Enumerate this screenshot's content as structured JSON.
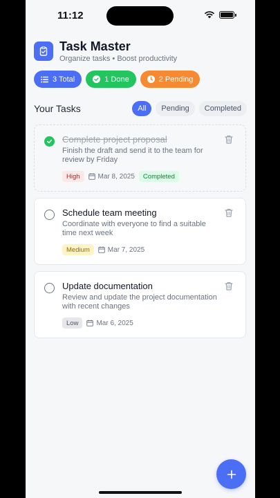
{
  "status_bar": {
    "time": "11:12"
  },
  "app": {
    "title": "Task Master",
    "subtitle": "Organize tasks • Boost productivity",
    "accent_color": "#4c6ef5"
  },
  "stats": {
    "total": "3 Total",
    "done": "1 Done",
    "pending": "2 Pending"
  },
  "section": {
    "title": "Your Tasks"
  },
  "filters": [
    {
      "label": "All",
      "active": true
    },
    {
      "label": "Pending",
      "active": false
    },
    {
      "label": "Completed",
      "active": false
    }
  ],
  "tasks": [
    {
      "title": "Complete project proposal",
      "description": "Finish the draft and send it to the team for review by Friday",
      "priority": "High",
      "date": "Mar 8, 2025",
      "status": "Completed",
      "done": true
    },
    {
      "title": "Schedule team meeting",
      "description": "Coordinate with everyone to find a suitable time next week",
      "priority": "Medium",
      "date": "Mar 7, 2025",
      "done": false
    },
    {
      "title": "Update documentation",
      "description": "Review and update the project documentation with recent changes",
      "priority": "Low",
      "date": "Mar 6, 2025",
      "done": false
    }
  ],
  "icons": {
    "fab": "plus-icon",
    "delete": "trash-icon",
    "date": "calendar-icon"
  }
}
